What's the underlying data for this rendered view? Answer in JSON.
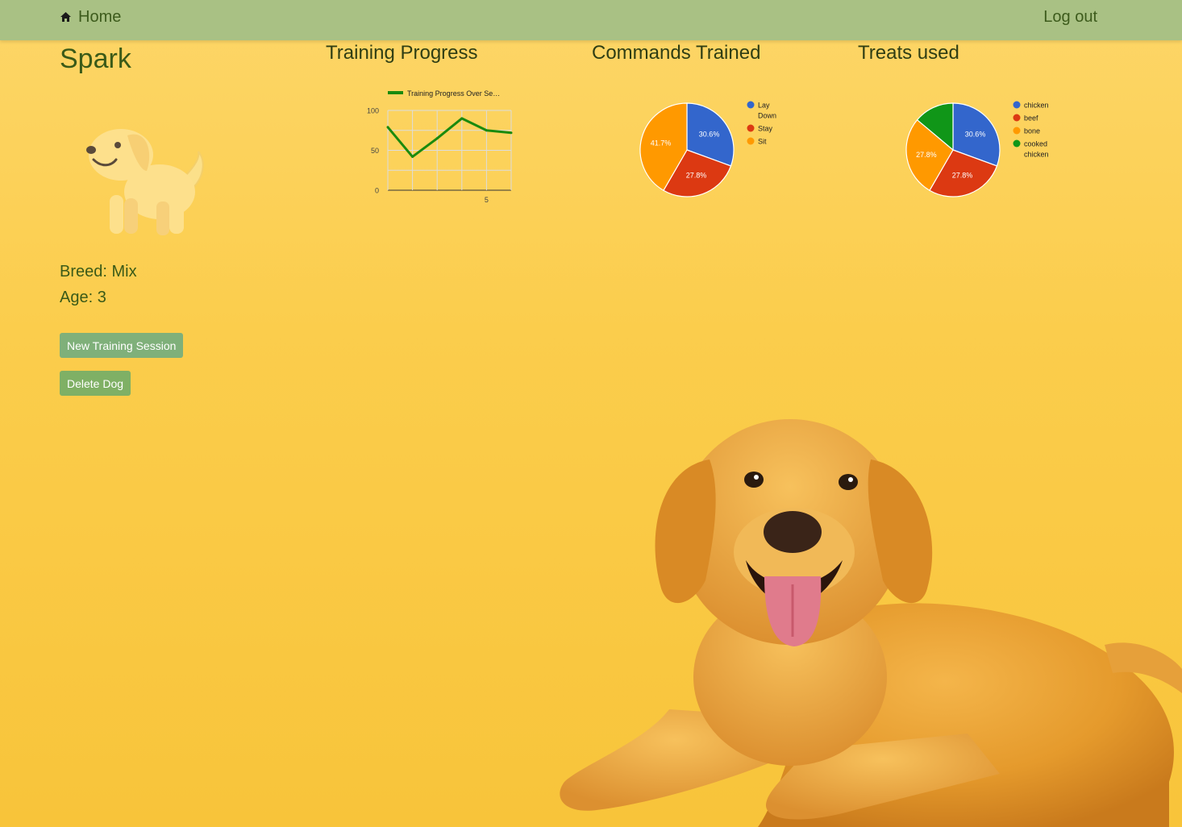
{
  "nav": {
    "home_label": "Home",
    "logout_label": "Log out"
  },
  "dog": {
    "name": "Spark",
    "breed_line": "Breed: Mix",
    "age_line": "Age: 3"
  },
  "actions": {
    "new_session_label": "New Training Session",
    "delete_dog_label": "Delete Dog"
  },
  "sections": {
    "training_title": "Training Progress",
    "commands_title": "Commands Trained",
    "treats_title": "Treats used"
  },
  "chart_data": [
    {
      "type": "line",
      "title": "",
      "series": [
        {
          "name": "Training Progress Over Se…",
          "color": "#1a8a0e",
          "x": [
            1,
            2,
            3,
            4,
            5,
            6
          ],
          "values": [
            79,
            42,
            65,
            90,
            75,
            72
          ]
        }
      ],
      "x_ticks": [
        "5"
      ],
      "y_ticks": [
        "0",
        "50",
        "100"
      ],
      "ylim": [
        0,
        100
      ],
      "grid": true,
      "legend": "top"
    },
    {
      "type": "pie",
      "title": "",
      "slices": [
        {
          "label": "Lay Down",
          "value": 30.6,
          "pct_label": "30.6%",
          "color": "#3366cc"
        },
        {
          "label": "Stay",
          "value": 27.8,
          "pct_label": "27.8%",
          "color": "#dc3912"
        },
        {
          "label": "Sit",
          "value": 41.7,
          "pct_label": "41.7%",
          "color": "#ff9900"
        }
      ],
      "legend": "right"
    },
    {
      "type": "pie",
      "title": "",
      "slices": [
        {
          "label": "chicken",
          "value": 30.6,
          "pct_label": "30.6%",
          "color": "#3366cc"
        },
        {
          "label": "beef",
          "value": 27.8,
          "pct_label": "27.8%",
          "color": "#dc3912"
        },
        {
          "label": "bone",
          "value": 27.8,
          "pct_label": "27.8%",
          "color": "#ff9900"
        },
        {
          "label": "cooked chicken",
          "value": 13.9,
          "pct_label": "",
          "color": "#109618"
        }
      ],
      "legend": "right"
    }
  ]
}
